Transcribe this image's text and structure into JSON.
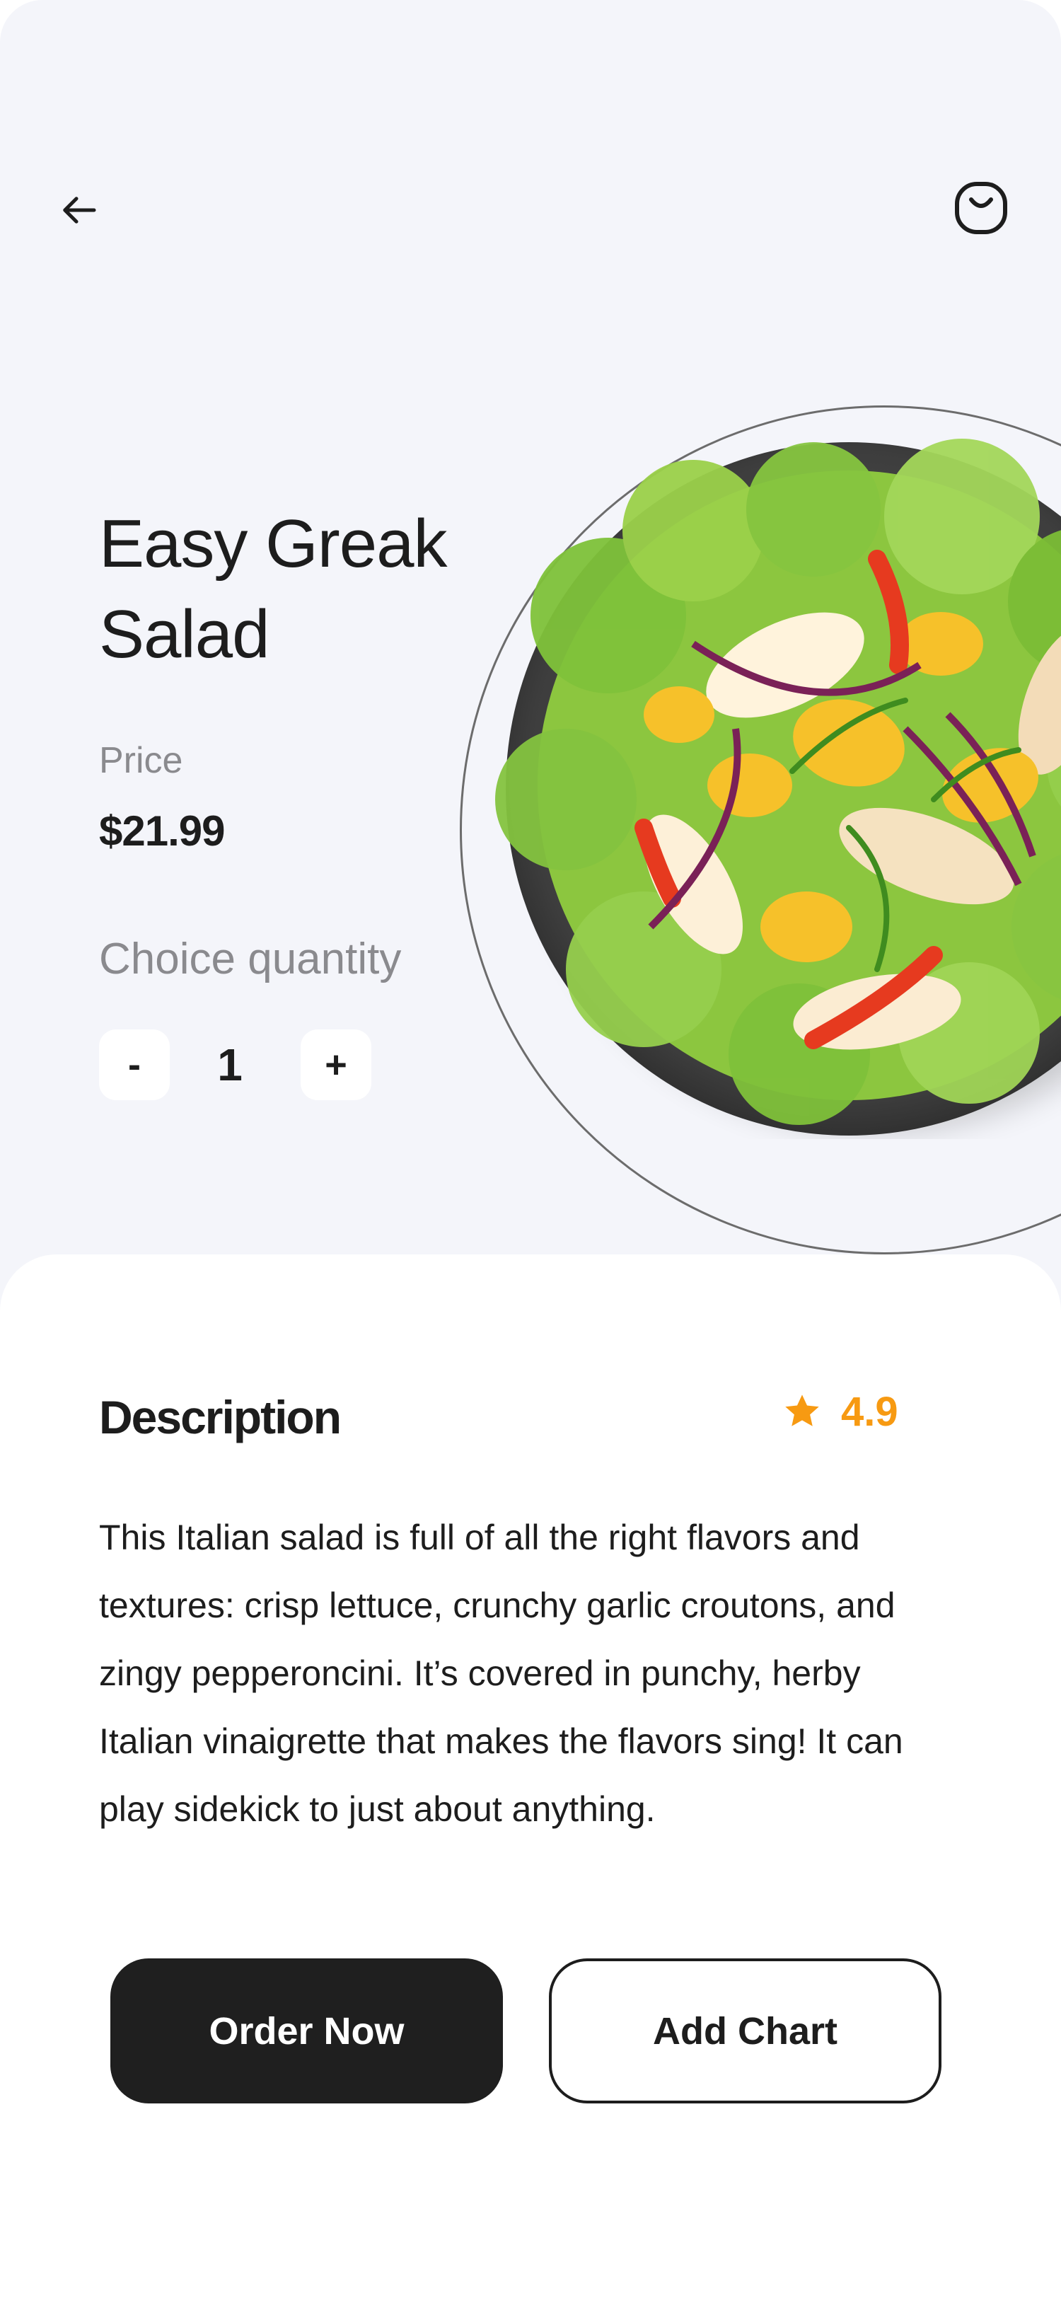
{
  "product": {
    "title": "Easy Greak Salad",
    "price_label": "Price",
    "price": "$21.99",
    "quantity_label": "Choice quantity",
    "quantity": "1",
    "decrement_label": "-",
    "increment_label": "+"
  },
  "description": {
    "heading": "Description",
    "rating": "4.9",
    "text": "This Italian salad is full of all the right flavors and textures: crisp lettuce, crunchy garlic croutons, and zingy pepperoncini. It’s covered in punchy, herby Italian vinaigrette that makes the flavors sing! It can play sidekick to just about anything."
  },
  "actions": {
    "order_label": "Order Now",
    "add_label": "Add Chart"
  },
  "icons": {
    "back": "arrow-left-icon",
    "cart": "bag-icon",
    "rating": "star-icon"
  },
  "colors": {
    "background": "#f4f5fa",
    "panel": "#ffffff",
    "primary_button": "#1f1f1f",
    "rating": "#f79a12",
    "muted_text": "#8a8a8e"
  }
}
